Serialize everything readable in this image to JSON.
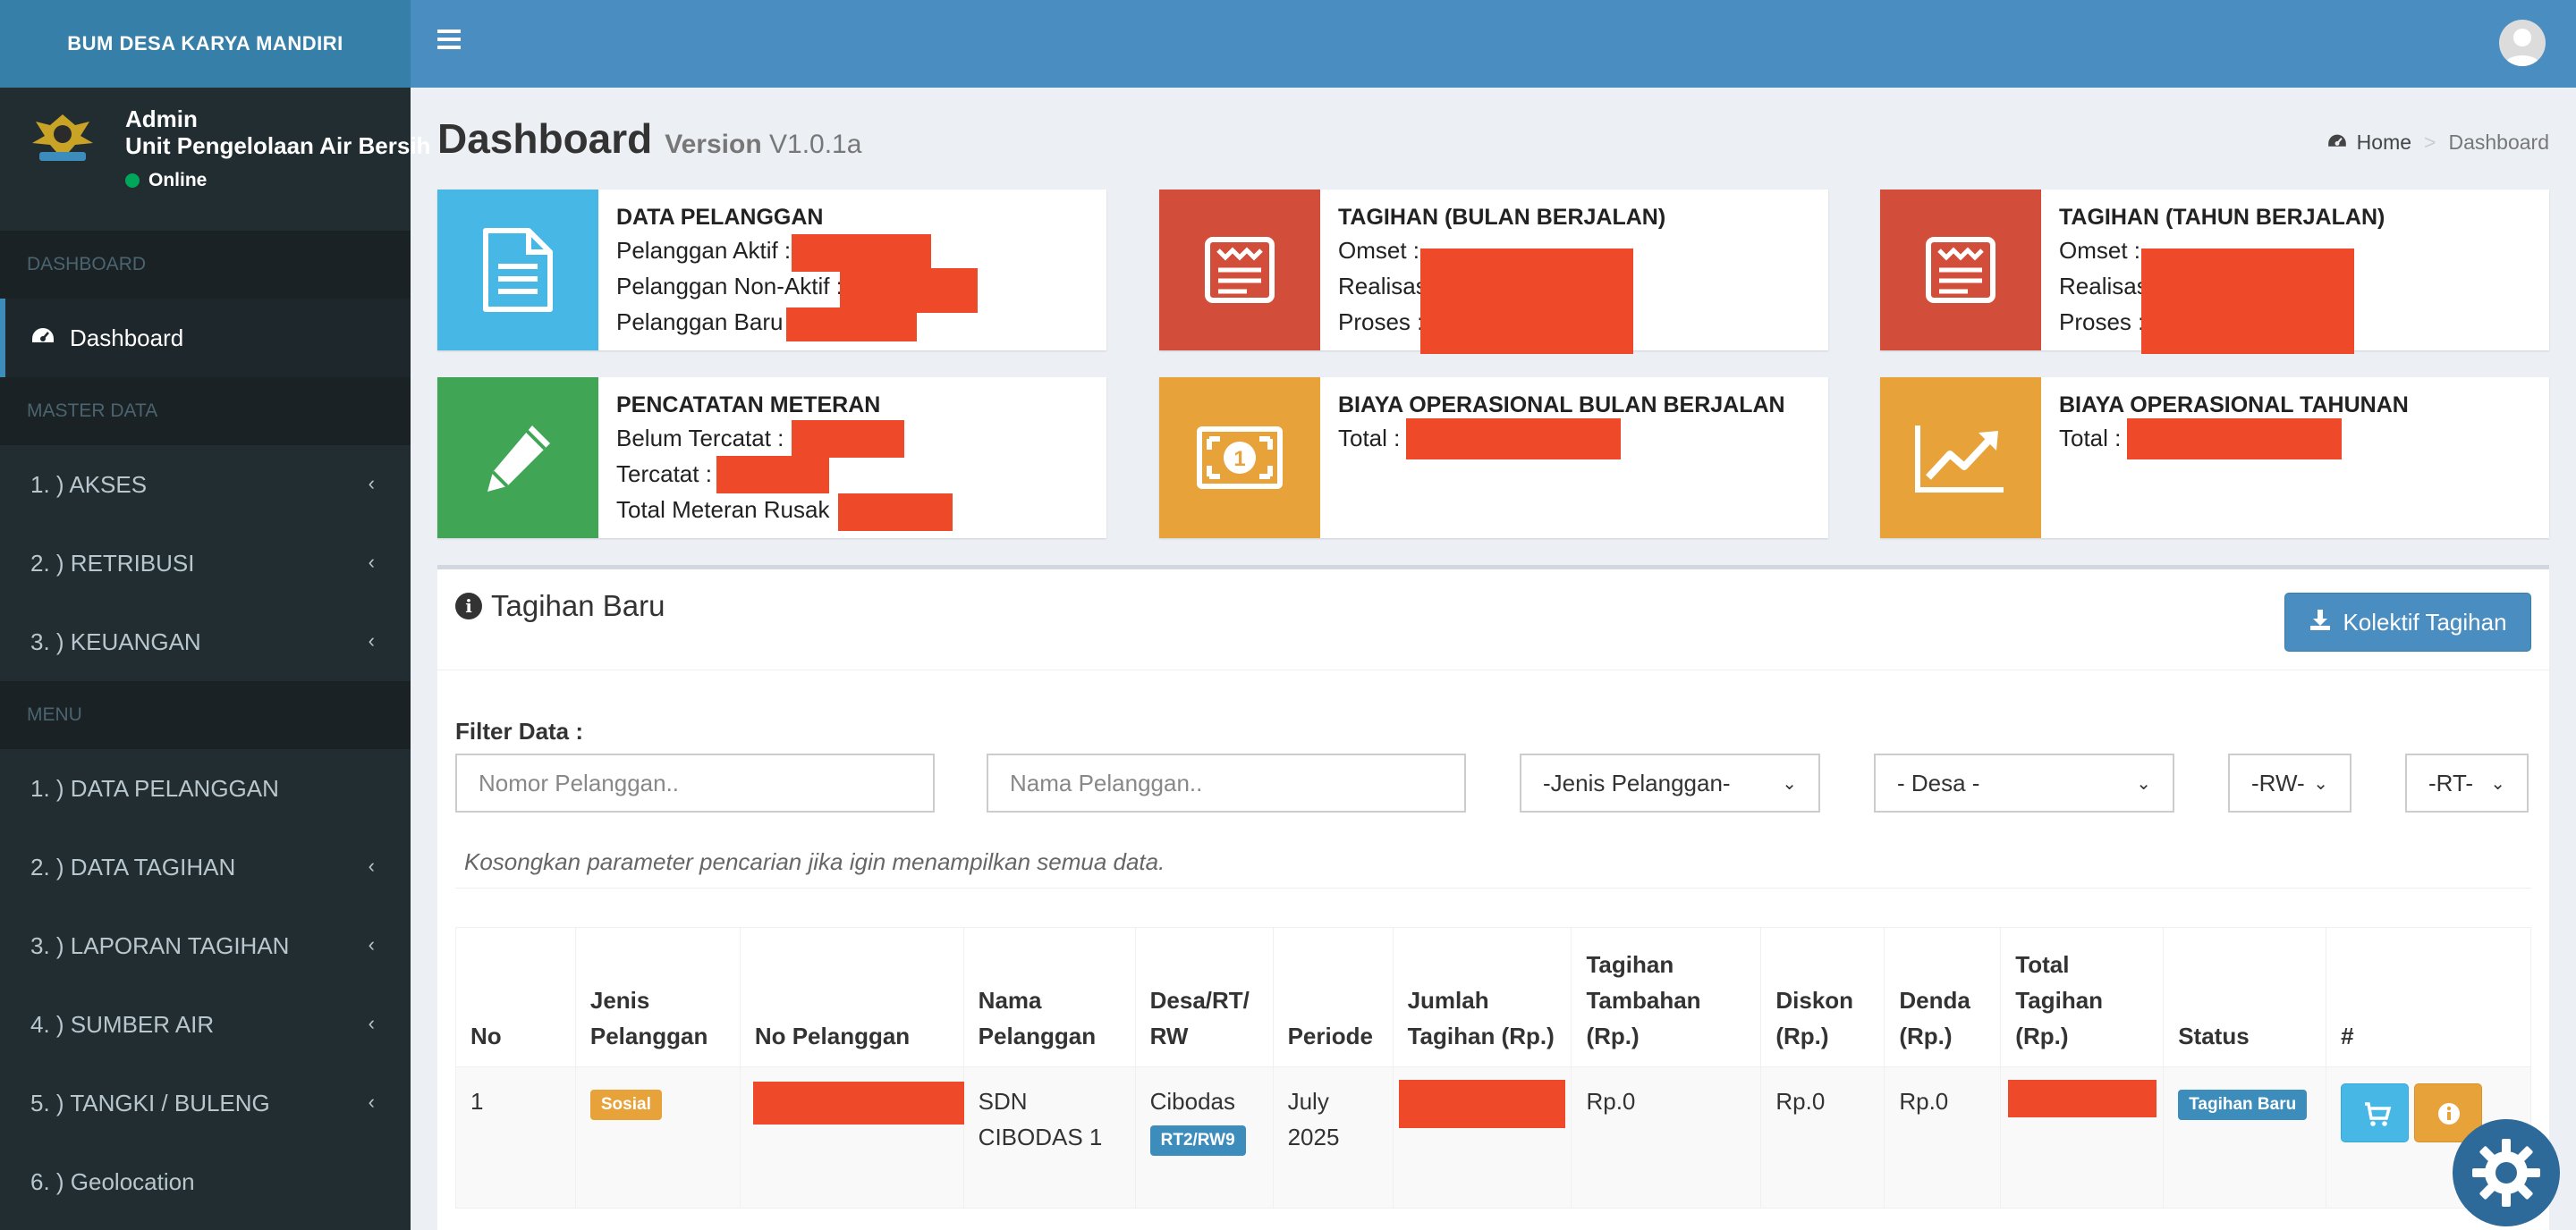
{
  "app": {
    "brand": "BUM DESA KARYA MANDIRI"
  },
  "user": {
    "name": "Admin",
    "unit": "Unit Pengelolaan Air Bersih",
    "status": "Online"
  },
  "sidebar": {
    "sections": [
      {
        "header": "DASHBOARD"
      },
      {
        "header": "MASTER DATA"
      },
      {
        "header": "MENU"
      }
    ],
    "dashboard_item": "Dashboard",
    "master_items": [
      {
        "label": "1. ) AKSES"
      },
      {
        "label": "2. ) RETRIBUSI"
      },
      {
        "label": "3. ) KEUANGAN"
      }
    ],
    "menu_items": [
      {
        "label": "1. ) DATA PELANGGAN"
      },
      {
        "label": "2. ) DATA TAGIHAN"
      },
      {
        "label": "3. ) LAPORAN TAGIHAN"
      },
      {
        "label": "4. ) SUMBER AIR"
      },
      {
        "label": "5. ) TANGKI / BULENG"
      },
      {
        "label": "6. ) Geolocation"
      }
    ]
  },
  "page": {
    "title": "Dashboard",
    "version_label": "Version",
    "version": "V1.0.1a",
    "breadcrumb": {
      "home": "Home",
      "current": "Dashboard"
    }
  },
  "info_boxes": {
    "pelanggan": {
      "title": "DATA PELANGGAN",
      "lines": [
        "Pelanggan Aktif :",
        "Pelanggan Non-Aktif :",
        "Pelanggan Baru :"
      ]
    },
    "tagihan_bulan": {
      "title": "TAGIHAN (BULAN BERJALAN)",
      "lines": [
        "Omset :",
        "Realisasi :",
        "Proses :"
      ]
    },
    "tagihan_tahun": {
      "title": "TAGIHAN (TAHUN BERJALAN)",
      "lines": [
        "Omset :",
        "Realisasi :",
        "Proses :"
      ]
    },
    "meteran": {
      "title": "PENCATATAN METERAN",
      "lines": [
        "Belum Tercatat :",
        "Tercatat :",
        "Total Meteran Rusak :"
      ]
    },
    "biaya_bulan": {
      "title": "BIAYA OPERASIONAL BULAN BERJALAN",
      "lines": [
        "Total :"
      ]
    },
    "biaya_tahun": {
      "title": "BIAYA OPERASIONAL TAHUNAN",
      "lines": [
        "Total :"
      ]
    }
  },
  "panel": {
    "title": "Tagihan Baru",
    "kolektif_button": "Kolektif Tagihan",
    "filter_label": "Filter Data :",
    "filters": {
      "nomor_placeholder": "Nomor Pelanggan..",
      "nama_placeholder": "Nama Pelanggan..",
      "jenis": "-Jenis Pelanggan-",
      "desa": "- Desa -",
      "rw": "-RW-",
      "rt": "-RT-"
    },
    "hint": "Kosongkan parameter pencarian jika igin menampilkan semua data."
  },
  "table": {
    "columns": {
      "no": "No",
      "jenis": [
        "Jenis",
        "Pelanggan"
      ],
      "nopel": "No Pelanggan",
      "nama": [
        "Nama",
        "Pelanggan"
      ],
      "desa": [
        "Desa/RT/",
        "RW"
      ],
      "periode": "Periode",
      "jumlah": [
        "Jumlah",
        "Tagihan (Rp.)"
      ],
      "tambahan": [
        "Tagihan",
        "Tambahan",
        "(Rp.)"
      ],
      "diskon": [
        "Diskon",
        "(Rp.)"
      ],
      "denda": [
        "Denda",
        "(Rp.)"
      ],
      "total": [
        "Total",
        "Tagihan",
        "(Rp.)"
      ],
      "status": "Status",
      "aksi": "#"
    },
    "rows": [
      {
        "no": "1",
        "jenis": "Sosial",
        "nama": [
          "SDN",
          "CIBODAS 1"
        ],
        "desa": "Cibodas",
        "rtrw": "RT2/RW9",
        "periode": [
          "July",
          "2025"
        ],
        "tambahan": "Rp.0",
        "diskon": "Rp.0",
        "denda": "Rp.0",
        "status": "Tagihan Baru"
      }
    ]
  },
  "colors": {
    "brand_blue": "#3c8dbc",
    "sidebar_dark": "#222d32",
    "aqua": "#47b8e6",
    "red": "#d24d3a",
    "green": "#40a656",
    "yellow": "#e8a23a",
    "redaction": "#ee4a2a"
  }
}
